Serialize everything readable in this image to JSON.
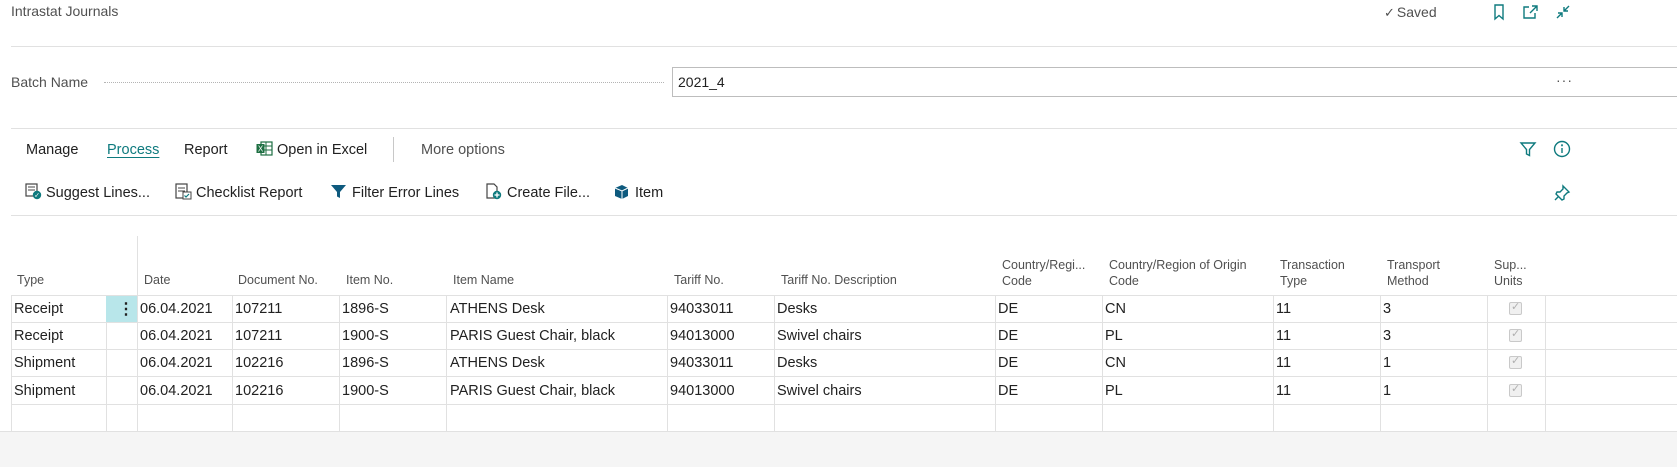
{
  "header": {
    "title": "Intrastat Journals",
    "saved_label": "Saved"
  },
  "batch": {
    "label": "Batch Name",
    "value": "2021_4",
    "more": "···"
  },
  "menu": {
    "manage": "Manage",
    "process": "Process",
    "report": "Report",
    "open_in_excel": "Open in Excel",
    "more_options": "More options"
  },
  "actions": {
    "suggest_lines": "Suggest Lines...",
    "checklist_report": "Checklist Report",
    "filter_error_lines": "Filter Error Lines",
    "create_file": "Create File...",
    "item": "Item"
  },
  "grid": {
    "columns": [
      {
        "line1": "Type",
        "line2": ""
      },
      {
        "line1": "Date",
        "line2": ""
      },
      {
        "line1": "Document No.",
        "line2": ""
      },
      {
        "line1": "Item No.",
        "line2": ""
      },
      {
        "line1": "Item Name",
        "line2": ""
      },
      {
        "line1": "Tariff No.",
        "line2": ""
      },
      {
        "line1": "Tariff No. Description",
        "line2": ""
      },
      {
        "line1": "Country/Regi...",
        "line2": "Code"
      },
      {
        "line1": "Country/Region of Origin",
        "line2": "Code"
      },
      {
        "line1": "Transaction",
        "line2": "Type"
      },
      {
        "line1": "Transport",
        "line2": "Method"
      },
      {
        "line1": "Sup...",
        "line2": "Units"
      }
    ],
    "rows": [
      {
        "type": "Receipt",
        "date": "06.04.2021",
        "doc": "107211",
        "item": "1896-S",
        "name": "ATHENS Desk",
        "tariff": "94033011",
        "tdesc": "Desks",
        "country": "DE",
        "origin": "CN",
        "ttype": "11",
        "tmethod": "3",
        "sup_units": true
      },
      {
        "type": "Receipt",
        "date": "06.04.2021",
        "doc": "107211",
        "item": "1900-S",
        "name": "PARIS Guest Chair, black",
        "tariff": "94013000",
        "tdesc": "Swivel chairs",
        "country": "DE",
        "origin": "PL",
        "ttype": "11",
        "tmethod": "3",
        "sup_units": true
      },
      {
        "type": "Shipment",
        "date": "06.04.2021",
        "doc": "102216",
        "item": "1896-S",
        "name": "ATHENS Desk",
        "tariff": "94033011",
        "tdesc": "Desks",
        "country": "DE",
        "origin": "CN",
        "ttype": "11",
        "tmethod": "1",
        "sup_units": true
      },
      {
        "type": "Shipment",
        "date": "06.04.2021",
        "doc": "102216",
        "item": "1900-S",
        "name": "PARIS Guest Chair, black",
        "tariff": "94013000",
        "tdesc": "Swivel chairs",
        "country": "DE",
        "origin": "PL",
        "ttype": "11",
        "tmethod": "1",
        "sup_units": true
      }
    ]
  },
  "colors": {
    "accent": "#0e7a7e",
    "selected_row_marker": "#b8e6ea"
  }
}
